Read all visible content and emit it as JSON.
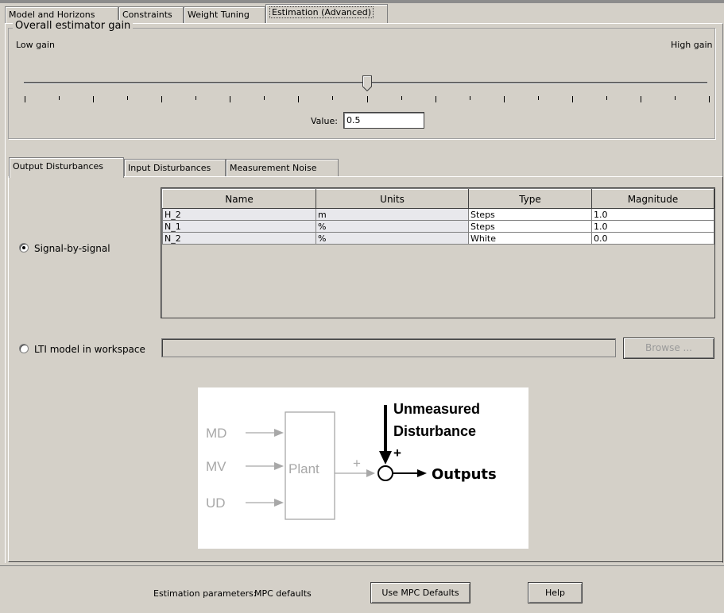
{
  "tabs": [
    {
      "label": "Model and Horizons",
      "active": false
    },
    {
      "label": "Constraints",
      "active": false
    },
    {
      "label": "Weight Tuning",
      "active": false
    },
    {
      "label": "Estimation (Advanced)",
      "active": true
    }
  ],
  "gain": {
    "title": "Overall estimator gain",
    "low_label": "Low gain",
    "high_label": "High gain",
    "value_label": "Value:",
    "value": "0.5",
    "slider_fraction": 0.5
  },
  "subtabs": [
    {
      "label": "Output Disturbances",
      "active": true
    },
    {
      "label": "Input Disturbances",
      "active": false
    },
    {
      "label": "Measurement Noise",
      "active": false
    }
  ],
  "signal_option": {
    "label": "Signal-by-signal",
    "selected": true
  },
  "table": {
    "columns": [
      "Name",
      "Units",
      "Type",
      "Magnitude"
    ],
    "rows": [
      [
        "H_2",
        "m",
        "Steps",
        "1.0"
      ],
      [
        "N_1",
        "%",
        "Steps",
        "1.0"
      ],
      [
        "N_2",
        "%",
        "White",
        "0.0"
      ]
    ]
  },
  "lti_option": {
    "label": "LTI model in workspace",
    "selected": false,
    "value": ""
  },
  "browse_label": "Browse ...",
  "diagram": {
    "inputs": [
      "MD",
      "MV",
      "UD"
    ],
    "plant": "Plant",
    "plus1": "+",
    "plus2": "+",
    "disturbance_line1": "Unmeasured",
    "disturbance_line2": "Disturbance",
    "outputs": "Outputs"
  },
  "footer": {
    "status_label": "Estimation parameters:",
    "status_value": "MPC defaults",
    "defaults_button": "Use MPC Defaults",
    "help_button": "Help"
  },
  "colors": {
    "background": "#d4d0c8",
    "readonly_cell": "#e8e8ec",
    "diagram_gray": "#a8a8a8"
  }
}
